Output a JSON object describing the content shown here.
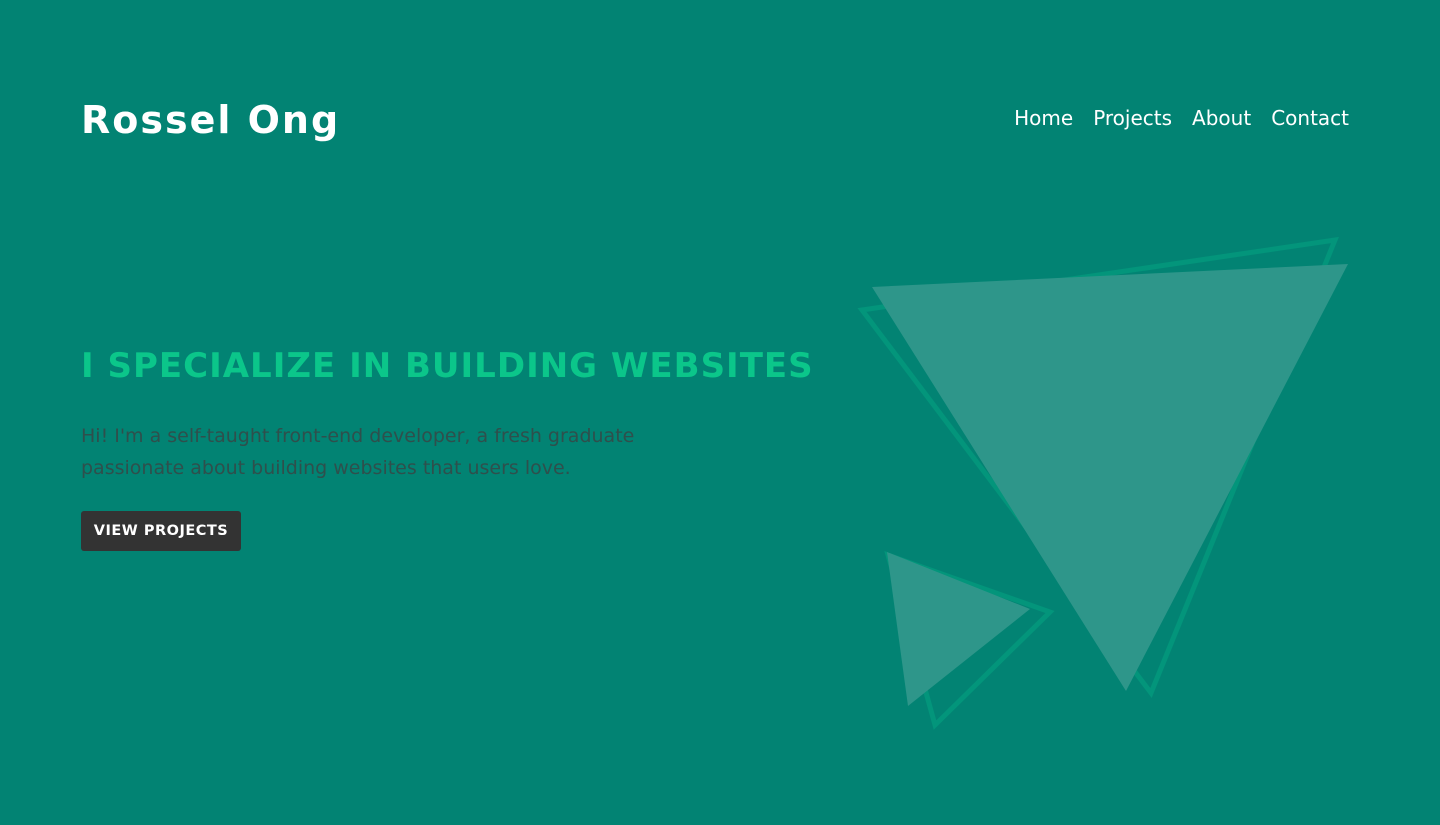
{
  "header": {
    "logo": "Rossel Ong",
    "nav": [
      "Home",
      "Projects",
      "About",
      "Contact"
    ]
  },
  "hero": {
    "headline": "I SPECIALIZE IN BUILDING WEBSITES",
    "intro": "Hi! I'm a self-taught front-end developer, a fresh graduate passionate about building websites that users love.",
    "cta_label": "VIEW PROJECTS"
  },
  "colors": {
    "background": "#028373",
    "accent": "#0bc68a",
    "button": "#333333",
    "shape_fill": "#2e968a",
    "shape_outline": "#03957b"
  },
  "icons": {
    "art": "decorative-triangles"
  }
}
